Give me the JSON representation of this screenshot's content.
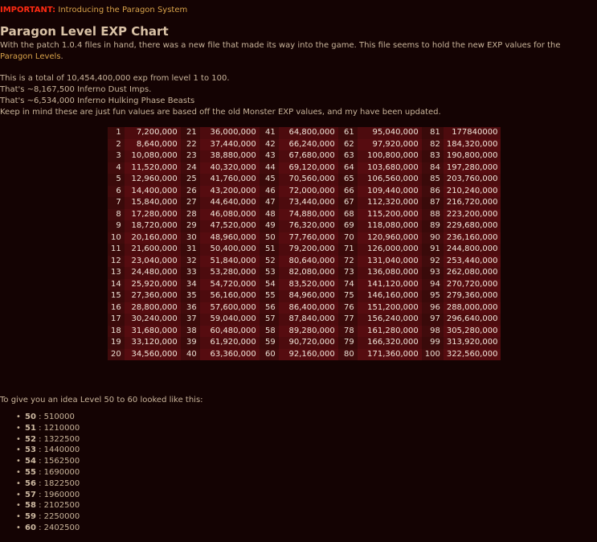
{
  "important": {
    "label": "IMPORTANT:",
    "link": "Introducing the Paragon System"
  },
  "title": "Paragon Level EXP Chart",
  "intro": {
    "text": "With the patch 1.0.4 files in hand, there was a new file that made its way into the game. This file seems to hold the new EXP values for the",
    "link": "Paragon Levels",
    "end": "."
  },
  "stats": [
    "This is a total of 10,454,400,000 exp from level 1 to 100.",
    "That's ~8,167,500 Inferno Dust Imps.",
    "That's ~6,534,000 Inferno Hulking Phase Beasts",
    "Keep in mind these are just fun values are based off the old Monster EXP values, and my have been updated."
  ],
  "table": {
    "rows": [
      [
        "1",
        "7,200,000",
        "21",
        "36,000,000",
        "41",
        "64,800,000",
        "61",
        "95,040,000",
        "81",
        "177840000"
      ],
      [
        "2",
        "8,640,000",
        "22",
        "37,440,000",
        "42",
        "66,240,000",
        "62",
        "97,920,000",
        "82",
        "184,320,000"
      ],
      [
        "3",
        "10,080,000",
        "23",
        "38,880,000",
        "43",
        "67,680,000",
        "63",
        "100,800,000",
        "83",
        "190,800,000"
      ],
      [
        "4",
        "11,520,000",
        "24",
        "40,320,000",
        "44",
        "69,120,000",
        "64",
        "103,680,000",
        "84",
        "197,280,000"
      ],
      [
        "5",
        "12,960,000",
        "25",
        "41,760,000",
        "45",
        "70,560,000",
        "65",
        "106,560,000",
        "85",
        "203,760,000"
      ],
      [
        "6",
        "14,400,000",
        "26",
        "43,200,000",
        "46",
        "72,000,000",
        "66",
        "109,440,000",
        "86",
        "210,240,000"
      ],
      [
        "7",
        "15,840,000",
        "27",
        "44,640,000",
        "47",
        "73,440,000",
        "67",
        "112,320,000",
        "87",
        "216,720,000"
      ],
      [
        "8",
        "17,280,000",
        "28",
        "46,080,000",
        "48",
        "74,880,000",
        "68",
        "115,200,000",
        "88",
        "223,200,000"
      ],
      [
        "9",
        "18,720,000",
        "29",
        "47,520,000",
        "49",
        "76,320,000",
        "69",
        "118,080,000",
        "89",
        "229,680,000"
      ],
      [
        "10",
        "20,160,000",
        "30",
        "48,960,000",
        "50",
        "77,760,000",
        "70",
        "120,960,000",
        "90",
        "236,160,000"
      ],
      [
        "11",
        "21,600,000",
        "31",
        "50,400,000",
        "51",
        "79,200,000",
        "71",
        "126,000,000",
        "91",
        "244,800,000"
      ],
      [
        "12",
        "23,040,000",
        "32",
        "51,840,000",
        "52",
        "80,640,000",
        "72",
        "131,040,000",
        "92",
        "253,440,000"
      ],
      [
        "13",
        "24,480,000",
        "33",
        "53,280,000",
        "53",
        "82,080,000",
        "73",
        "136,080,000",
        "93",
        "262,080,000"
      ],
      [
        "14",
        "25,920,000",
        "34",
        "54,720,000",
        "54",
        "83,520,000",
        "74",
        "141,120,000",
        "94",
        "270,720,000"
      ],
      [
        "15",
        "27,360,000",
        "35",
        "56,160,000",
        "55",
        "84,960,000",
        "75",
        "146,160,000",
        "95",
        "279,360,000"
      ],
      [
        "16",
        "28,800,000",
        "36",
        "57,600,000",
        "56",
        "86,400,000",
        "76",
        "151,200,000",
        "96",
        "288,000,000"
      ],
      [
        "17",
        "30,240,000",
        "37",
        "59,040,000",
        "57",
        "87,840,000",
        "77",
        "156,240,000",
        "97",
        "296,640,000"
      ],
      [
        "18",
        "31,680,000",
        "38",
        "60,480,000",
        "58",
        "89,280,000",
        "78",
        "161,280,000",
        "98",
        "305,280,000"
      ],
      [
        "19",
        "33,120,000",
        "39",
        "61,920,000",
        "59",
        "90,720,000",
        "79",
        "166,320,000",
        "99",
        "313,920,000"
      ],
      [
        "20",
        "34,560,000",
        "40",
        "63,360,000",
        "60",
        "92,160,000",
        "80",
        "171,360,000",
        "100",
        "322,560,000"
      ]
    ]
  },
  "note": "To give you an idea Level 50 to 60 looked like this:",
  "old_values": [
    {
      "level": "50",
      "sep": " : ",
      "value": "510000"
    },
    {
      "level": "51",
      "sep": " : ",
      "value": "1210000"
    },
    {
      "level": "52",
      "sep": " : ",
      "value": "1322500"
    },
    {
      "level": "53",
      "sep": " : ",
      "value": "1440000"
    },
    {
      "level": "54",
      "sep": " : ",
      "value": "1562500"
    },
    {
      "level": "55",
      "sep": " : ",
      "value": "1690000"
    },
    {
      "level": "56",
      "sep": " : ",
      "value": "1822500"
    },
    {
      "level": "57",
      "sep": " : ",
      "value": "1960000"
    },
    {
      "level": "58",
      "sep": " : ",
      "value": "2102500"
    },
    {
      "level": "59",
      "sep": " : ",
      "value": "2250000"
    },
    {
      "level": "60",
      "sep": " : ",
      "value": "2402500"
    }
  ]
}
